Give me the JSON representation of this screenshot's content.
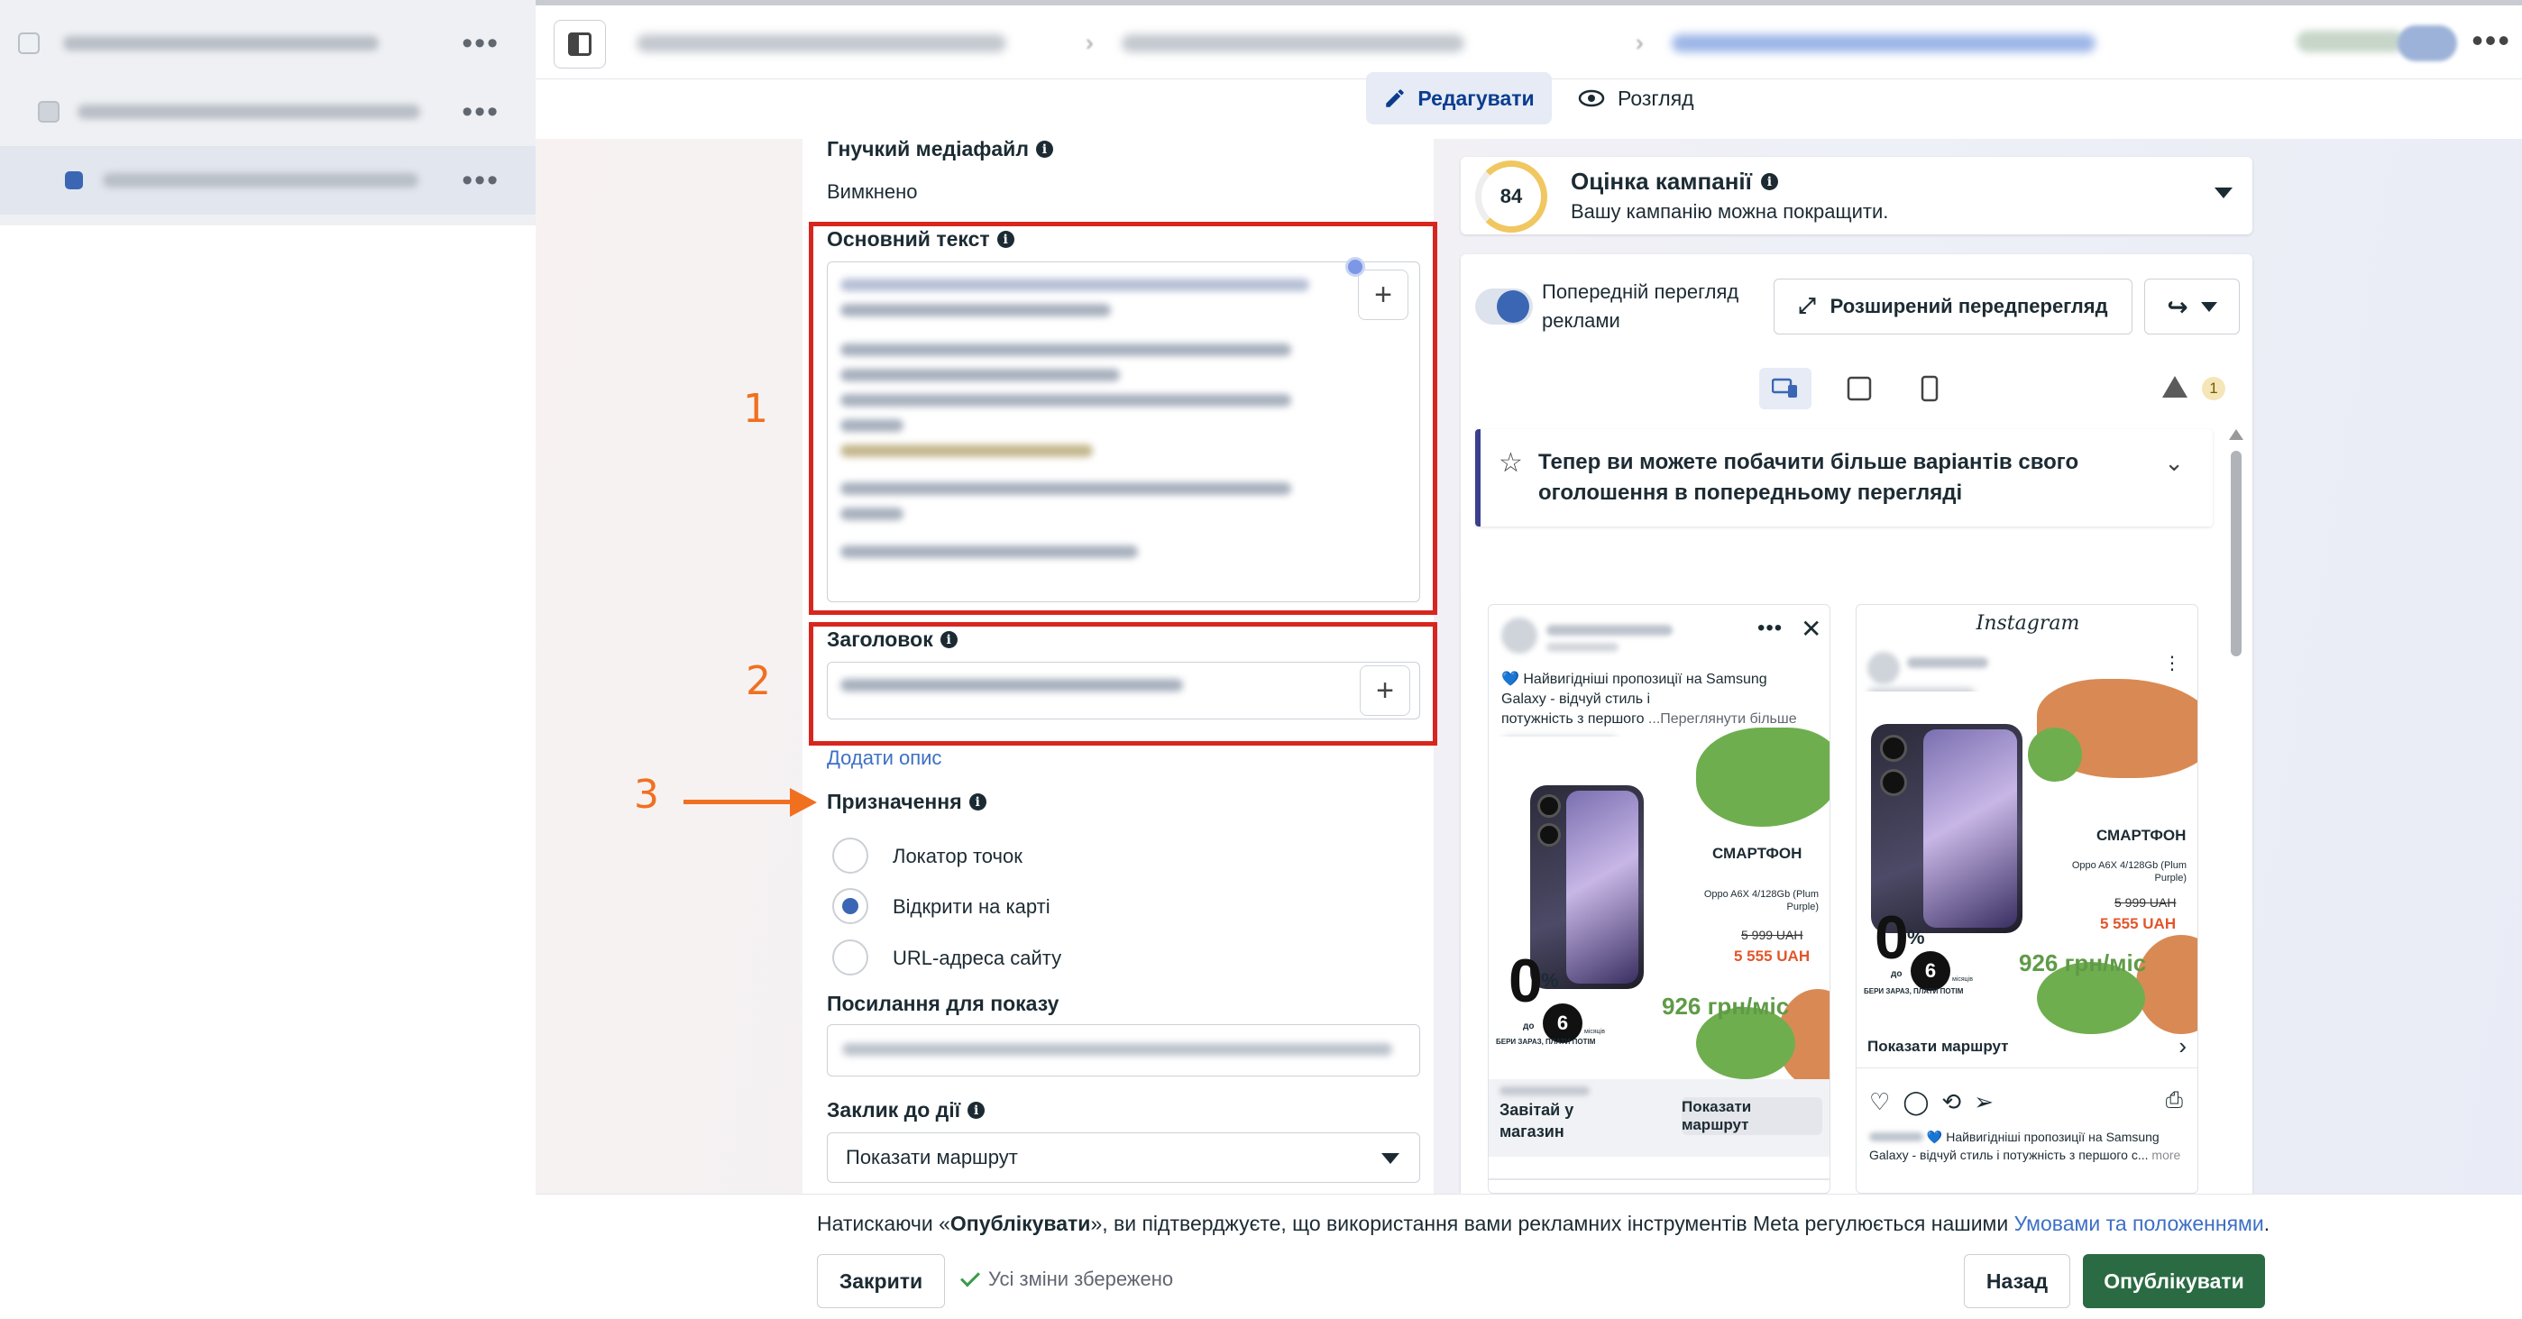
{
  "tabs": {
    "edit_label": "Редагувати",
    "preview_label": "Розгляд"
  },
  "form": {
    "flex_media": {
      "label": "Гнучкий медіафайл",
      "value": "Вимкнено"
    },
    "primary_text": {
      "label": "Основний текст"
    },
    "headline": {
      "label": "Заголовок"
    },
    "add_description": "Додати опис",
    "destination": {
      "label": "Призначення",
      "options": [
        "Локатор точок",
        "Відкрити на карті",
        "URL-адреса сайту"
      ],
      "selected": "Відкрити на карті"
    },
    "display_link": {
      "label": "Посилання для показу"
    },
    "cta": {
      "label": "Заклик до дії",
      "value": "Показати маршрут"
    }
  },
  "annotations": [
    "1",
    "2",
    "3"
  ],
  "campaign_score": {
    "score": "84",
    "title": "Оцінка кампанії",
    "subtitle": "Вашу кампанію можна покращити."
  },
  "preview": {
    "toggle_label": "Попередній перегляд рекламі",
    "toggle_label_line1": "Попередній перегляд",
    "toggle_label_line2": "реклами",
    "advanced_button": "Розширений передперегляд",
    "warning_count": "1",
    "notice": "Тепер ви можете побачити більше варіантів свого оголошення в попередньому перегляді",
    "facebook_ad": {
      "text_line1": "💙 Найвигідніші пропозиції на Samsung",
      "text_line2": "Galaxy - відчуй стиль і",
      "text_line3": "потужність з першого",
      "see_more": "...Переглянути більше",
      "headline_line1": "Завітай у",
      "headline_line2": "магазин",
      "cta": "Показати маршрут"
    },
    "instagram_ad": {
      "platform": "Instagram",
      "cta": "Показати маршрут",
      "caption_line1": "💙 Найвигідніші пропозиції на Samsung",
      "caption_line2": "Galaxy - відчуй стиль і потужність з першого с...",
      "more": "more"
    },
    "creative": {
      "product": "СМАРТФОН",
      "model_line1": "Oppo A6X 4/128Gb (Plum",
      "model_line2": "Purple)",
      "old_price": "5 999 UAH",
      "new_price": "5 555 UAH",
      "monthly": "926 грн/міс",
      "zero": "0",
      "percent": "%",
      "do": "до",
      "months": "6",
      "months_word": "місяців",
      "fine": "БЕРИ ЗАРАЗ, ПЛАТИ ПОТІМ"
    }
  },
  "footer": {
    "note_prefix": "Натискаючи «",
    "note_bold": "Опублікувати",
    "note_middle": "», ви підтверджуєте, що використання вами рекламних інструментів Meta регулюється нашими ",
    "note_link": "Умовами та положеннями",
    "note_suffix": ".",
    "close": "Закрити",
    "saved": "Усі зміни збережено",
    "back": "Назад",
    "publish": "Опублікувати"
  },
  "colors": {
    "annotation_box": "#d8261f",
    "annotation_text": "#f07020",
    "publish": "#2b6b43",
    "link": "#3d6fc5"
  }
}
